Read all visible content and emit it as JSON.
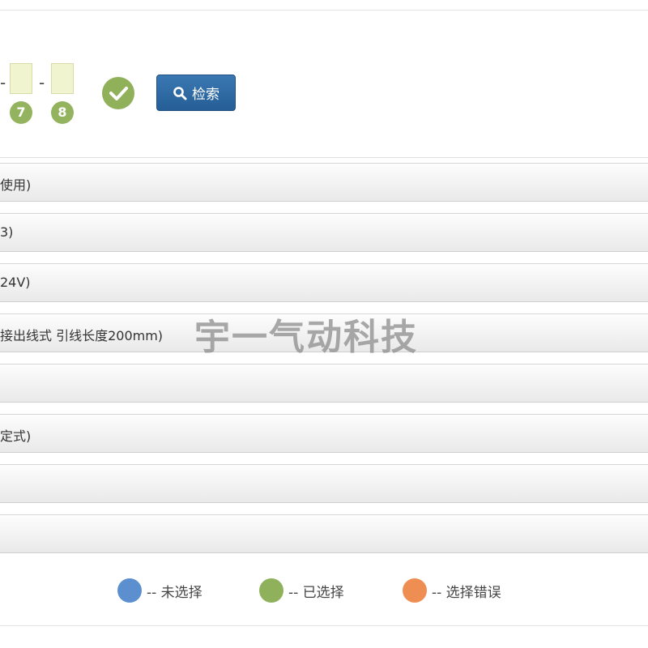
{
  "builder": {
    "dash_1": "-",
    "dash_2": "-",
    "slot_7_number": "7",
    "slot_8_number": "8",
    "search_label": "检索"
  },
  "options": [
    {
      "label": "使用)"
    },
    {
      "label": "3)"
    },
    {
      "label": "24V)"
    },
    {
      "label": "接出线式 引线长度200mm)"
    },
    {
      "label": ""
    },
    {
      "label": "定式)"
    },
    {
      "label": ""
    },
    {
      "label": ""
    }
  ],
  "watermark": "宇一气动科技",
  "legend": [
    {
      "text": "-- 未选择",
      "color": "#5b8fcf"
    },
    {
      "text": "-- 已选择",
      "color": "#8fb15c"
    },
    {
      "text": "-- 选择错误",
      "color": "#ef8e52"
    }
  ],
  "colors": {
    "slot_fill": "#f0f5cf",
    "number_badge": "#93b35f",
    "check_badge": "#90b05a",
    "search_button": "#2f6aa5"
  },
  "icons": {
    "check": "check-icon",
    "search": "search-icon"
  }
}
